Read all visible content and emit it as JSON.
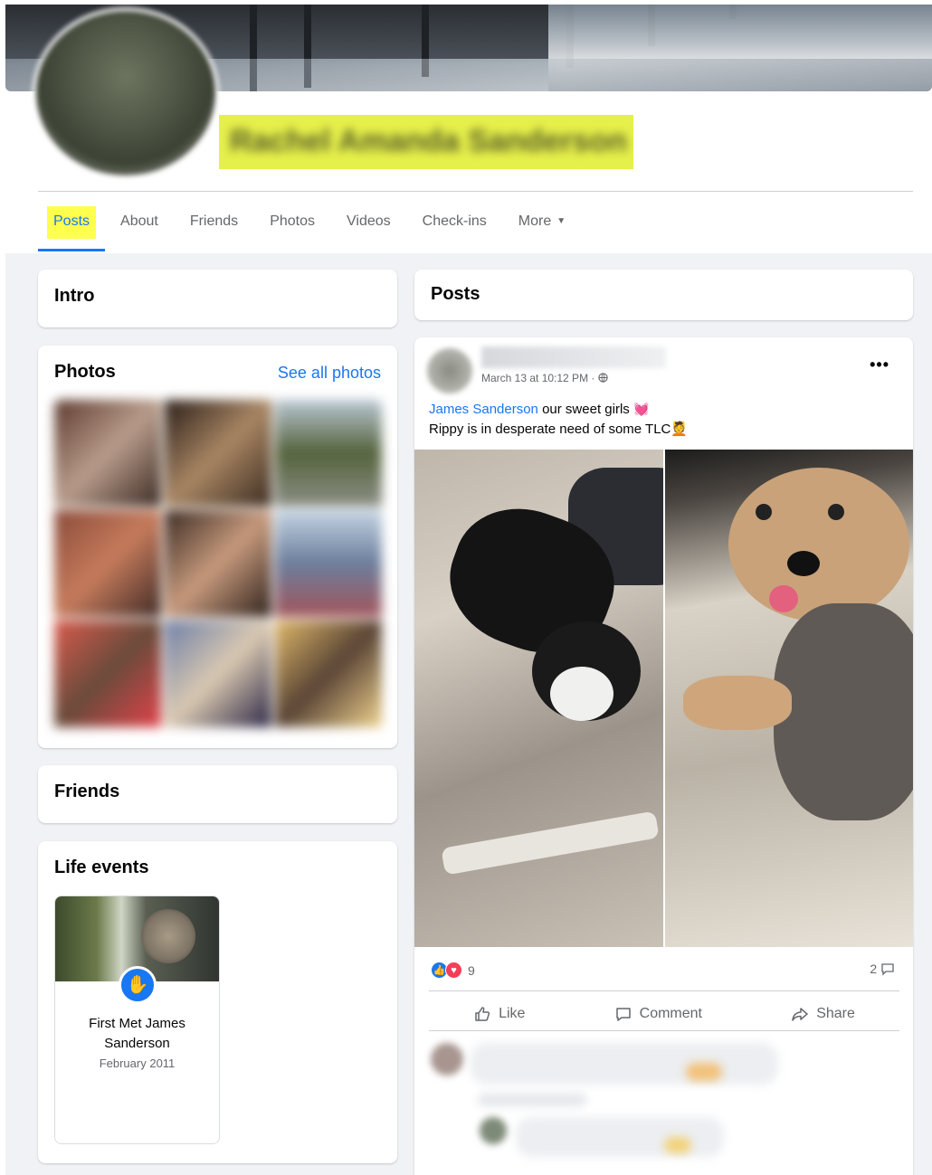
{
  "profile": {
    "name": "Rachel Amanda Sanderson"
  },
  "tabs": [
    {
      "label": "Posts"
    },
    {
      "label": "About"
    },
    {
      "label": "Friends"
    },
    {
      "label": "Photos"
    },
    {
      "label": "Videos"
    },
    {
      "label": "Check-ins"
    },
    {
      "label": "More"
    }
  ],
  "left": {
    "intro_title": "Intro",
    "photos_title": "Photos",
    "see_all": "See all photos",
    "friends_title": "Friends",
    "life_events_title": "Life events",
    "life_event": {
      "title": "First Met James Sanderson",
      "date": "February 2011"
    }
  },
  "right": {
    "posts_title": "Posts",
    "post": {
      "meta": "March 13 at 10:12 PM ·",
      "mention": "James Sanderson",
      "text_line1": " our sweet girls ",
      "text_line2": "Rippy is in desperate need of some TLC",
      "reaction_count": "9",
      "comment_count": "2",
      "actions": {
        "like": "Like",
        "comment": "Comment",
        "share": "Share"
      }
    }
  },
  "colors": {
    "accent": "#1877f2",
    "highlight": "#ffff4d",
    "name_highlight": "#e6f04a",
    "page_bg": "#f0f2f5"
  },
  "icons": [
    "globe-icon",
    "more-icon",
    "like-icon",
    "comment-icon",
    "share-icon",
    "wave-icon",
    "heart-icon",
    "caret-down-icon"
  ]
}
